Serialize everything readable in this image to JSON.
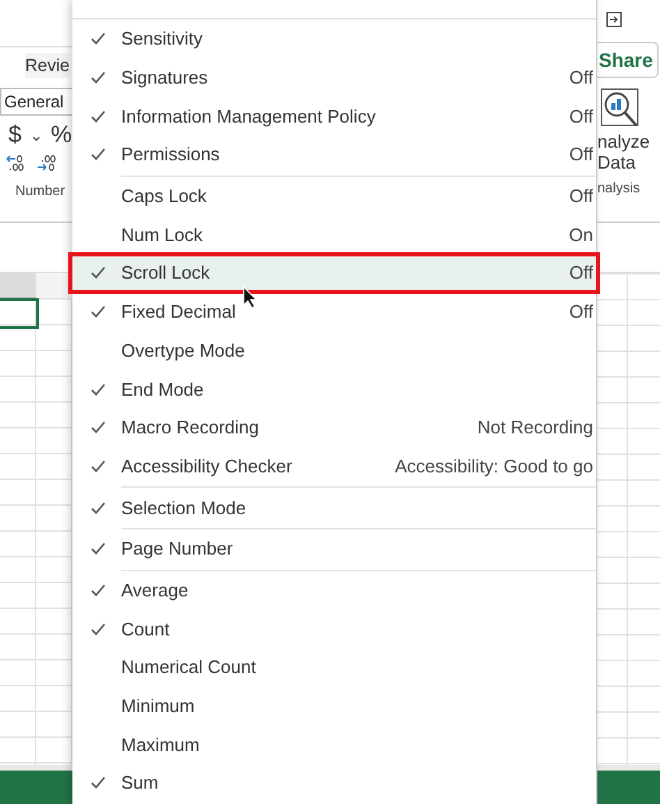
{
  "ribbon_left": {
    "tab": "Revie",
    "number_format": "General",
    "currency": "$",
    "dropdown": "⌄",
    "percent": "%",
    "group_label": "Number"
  },
  "ribbon_right": {
    "share": "Share",
    "analyze_lines": [
      "nalyze",
      "Data"
    ],
    "group_label": "nalysis"
  },
  "menu": {
    "groups": [
      {
        "items": [
          {
            "label": "Sensitivity",
            "checked": true,
            "selected": false
          },
          {
            "label": "Signatures",
            "checked": true,
            "value": "Off",
            "selected": false
          },
          {
            "label": "Information Management Policy",
            "checked": true,
            "value": "Off",
            "selected": false
          },
          {
            "label": "Permissions",
            "checked": true,
            "value": "Off",
            "selected": false
          }
        ]
      },
      {
        "items": [
          {
            "label": "Caps Lock",
            "checked": false,
            "value": "Off",
            "selected": false
          },
          {
            "label": "Num Lock",
            "checked": false,
            "value": "On",
            "selected": false
          },
          {
            "label": "Scroll Lock",
            "checked": true,
            "value": "Off",
            "selected": true
          },
          {
            "label": "Fixed Decimal",
            "checked": true,
            "value": "Off",
            "selected": false
          },
          {
            "label": "Overtype Mode",
            "checked": false,
            "selected": false
          },
          {
            "label": "End Mode",
            "checked": true,
            "selected": false
          },
          {
            "label": "Macro Recording",
            "checked": true,
            "value": "Not Recording",
            "selected": false
          },
          {
            "label": "Accessibility Checker",
            "checked": true,
            "value": "Accessibility: Good to go",
            "selected": false
          }
        ]
      },
      {
        "items": [
          {
            "label": "Selection Mode",
            "checked": true,
            "selected": false
          }
        ]
      },
      {
        "items": [
          {
            "label": "Page Number",
            "checked": true,
            "selected": false
          }
        ]
      },
      {
        "items": [
          {
            "label": "Average",
            "checked": true,
            "selected": false
          },
          {
            "label": "Count",
            "checked": true,
            "selected": false
          },
          {
            "label": "Numerical Count",
            "checked": false,
            "selected": false
          },
          {
            "label": "Minimum",
            "checked": false,
            "selected": false
          },
          {
            "label": "Maximum",
            "checked": false,
            "selected": false
          },
          {
            "label": "Sum",
            "checked": true,
            "selected": false
          }
        ]
      }
    ]
  }
}
